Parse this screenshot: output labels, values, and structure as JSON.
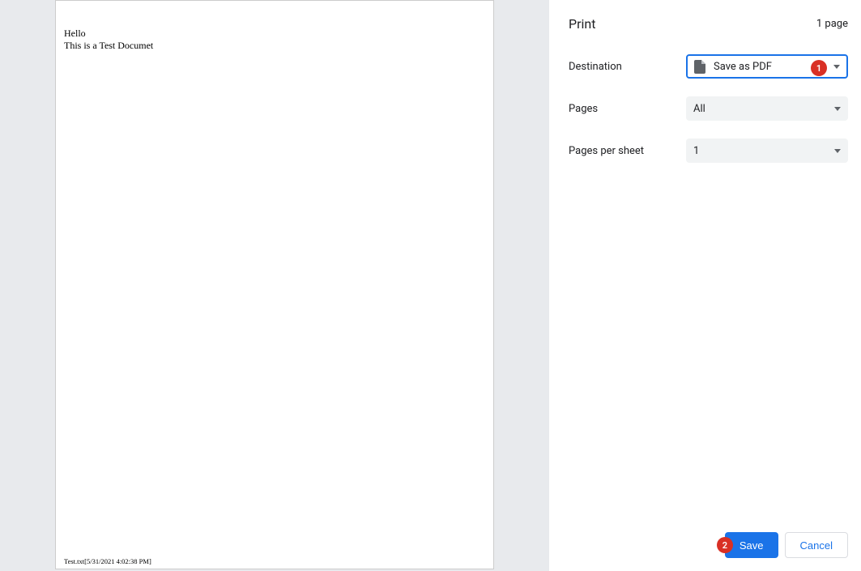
{
  "preview": {
    "line1": "Hello",
    "line2": "This is a Test Documet",
    "footer": "Test.txt[5/31/2021 4:02:38 PM]"
  },
  "sidebar": {
    "title": "Print",
    "page_count": "1 page",
    "destination_label": "Destination",
    "destination_value": "Save as PDF",
    "pages_label": "Pages",
    "pages_value": "All",
    "pps_label": "Pages per sheet",
    "pps_value": "1",
    "save_label": "Save",
    "cancel_label": "Cancel"
  },
  "annotations": {
    "badge1": "1",
    "badge2": "2"
  }
}
